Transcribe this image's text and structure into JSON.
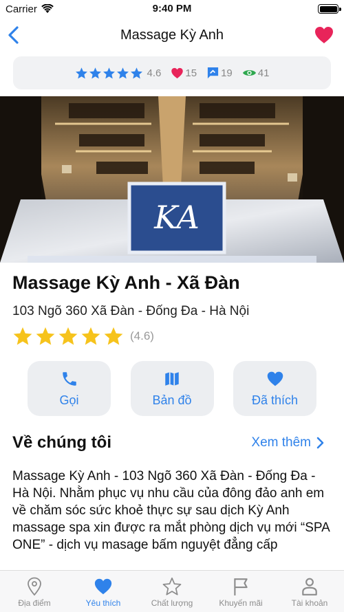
{
  "status_bar": {
    "carrier": "Carrier",
    "time": "9:40 PM"
  },
  "nav": {
    "title": "Massage Kỳ Anh",
    "favorite_color": "#e8245a"
  },
  "stats": {
    "rating": "4.6",
    "likes": "15",
    "comments": "19",
    "views": "41"
  },
  "place": {
    "name": "Massage Kỳ Anh - Xã Đàn",
    "address": "103 Ngõ 360 Xã Đàn - Đống Đa - Hà Nội",
    "rating_text": "(4.6)",
    "rating_value": 4.6
  },
  "actions": [
    {
      "label": "Gọi",
      "icon": "phone-icon"
    },
    {
      "label": "Bản đồ",
      "icon": "map-icon"
    },
    {
      "label": "Đã thích",
      "icon": "heart-icon"
    }
  ],
  "about": {
    "heading": "Về chúng tôi",
    "see_more": "Xem thêm",
    "text": "Massage Kỳ Anh - 103 Ngõ 360 Xã Đàn - Đống Đa - Hà Nội. Nhằm phục vụ nhu cầu của đông đảo anh em về chăm sóc sức khoẻ thực sự sau dịch Kỳ Anh massage spa xin được ra mắt phòng dịch vụ mới “SPA ONE” - dịch vụ masage bấm nguyệt đẳng cấp"
  },
  "tabs": [
    {
      "label": "Địa điểm",
      "icon": "location-pin-icon",
      "active": false
    },
    {
      "label": "Yêu thích",
      "icon": "heart-icon",
      "active": true
    },
    {
      "label": "Chất lượng",
      "icon": "star-icon",
      "active": false
    },
    {
      "label": "Khuyến mãi",
      "icon": "flag-icon",
      "active": false
    },
    {
      "label": "Tài khoản",
      "icon": "user-icon",
      "active": false
    }
  ],
  "colors": {
    "accent": "#2f82ea",
    "star_gold": "#f6c31c",
    "heart_red": "#e8245a",
    "views_green": "#2fa84f"
  }
}
